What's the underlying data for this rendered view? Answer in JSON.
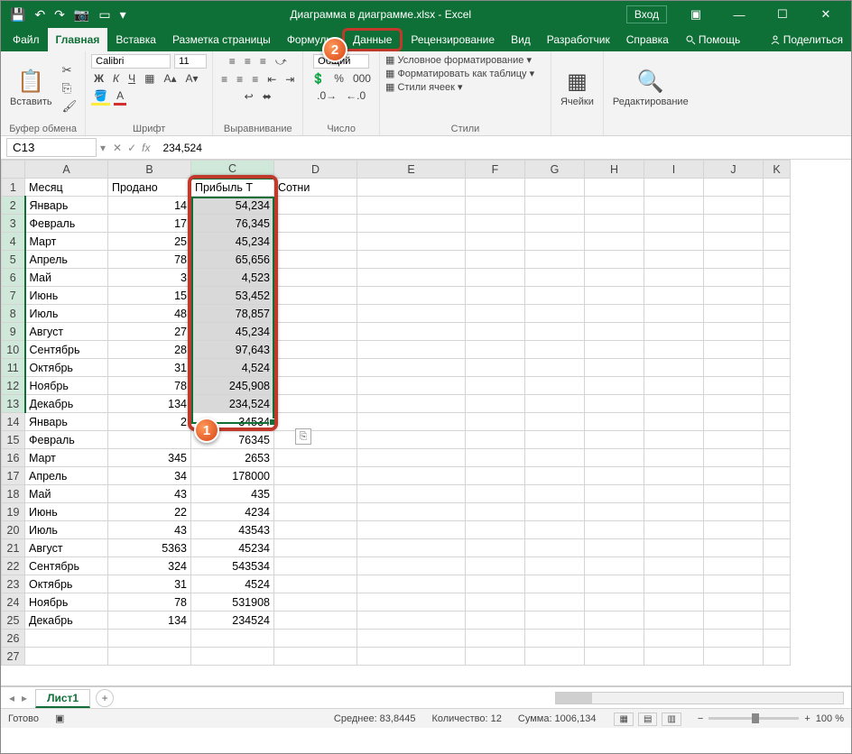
{
  "title": "Диаграмма в диаграмме.xlsx  -  Excel",
  "signin": "Вход",
  "tabs": [
    "Файл",
    "Главная",
    "Вставка",
    "Разметка страницы",
    "Формулы",
    "Данные",
    "Рецензирование",
    "Вид",
    "Разработчик",
    "Справка",
    "Помощь",
    "Поделиться"
  ],
  "ribbon": {
    "clipboard": {
      "paste": "Вставить",
      "label": "Буфер обмена"
    },
    "font": {
      "name": "Calibri",
      "size": "11",
      "label": "Шрифт"
    },
    "align": {
      "label": "Выравнивание"
    },
    "number": {
      "format": "Общий",
      "label": "Число"
    },
    "styles": {
      "cond": "Условное форматирование",
      "table": "Форматировать как таблицу",
      "cell": "Стили ячеек",
      "label": "Стили"
    },
    "cells": {
      "label": "Ячейки"
    },
    "editing": {
      "label": "Редактирование"
    }
  },
  "fx": {
    "name": "C13",
    "formula": "234,524"
  },
  "cols": [
    "A",
    "B",
    "C",
    "D",
    "E",
    "F",
    "G",
    "H",
    "I",
    "J",
    "K"
  ],
  "headers": {
    "A": "Месяц",
    "B": "Продано",
    "C": "Прибыль Т",
    "D": "Сотни"
  },
  "rows": [
    {
      "n": 1,
      "A": "Месяц",
      "B": "Продано",
      "C": "Прибыль Т",
      "D": "Сотни"
    },
    {
      "n": 2,
      "A": "Январь",
      "B": "14",
      "C": "54,234"
    },
    {
      "n": 3,
      "A": "Февраль",
      "B": "17",
      "C": "76,345"
    },
    {
      "n": 4,
      "A": "Март",
      "B": "25",
      "C": "45,234"
    },
    {
      "n": 5,
      "A": "Апрель",
      "B": "78",
      "C": "65,656"
    },
    {
      "n": 6,
      "A": "Май",
      "B": "3",
      "C": "4,523"
    },
    {
      "n": 7,
      "A": "Июнь",
      "B": "15",
      "C": "53,452"
    },
    {
      "n": 8,
      "A": "Июль",
      "B": "48",
      "C": "78,857"
    },
    {
      "n": 9,
      "A": "Август",
      "B": "27",
      "C": "45,234"
    },
    {
      "n": 10,
      "A": "Сентябрь",
      "B": "28",
      "C": "97,643"
    },
    {
      "n": 11,
      "A": "Октябрь",
      "B": "31",
      "C": "4,524"
    },
    {
      "n": 12,
      "A": "Ноябрь",
      "B": "78",
      "C": "245,908"
    },
    {
      "n": 13,
      "A": "Декабрь",
      "B": "134",
      "C": "234,524"
    },
    {
      "n": 14,
      "A": "Январь",
      "B": "2",
      "C": "34534"
    },
    {
      "n": 15,
      "A": "Февраль",
      "B": "",
      "C": "76345"
    },
    {
      "n": 16,
      "A": "Март",
      "B": "345",
      "C": "2653"
    },
    {
      "n": 17,
      "A": "Апрель",
      "B": "34",
      "C": "178000"
    },
    {
      "n": 18,
      "A": "Май",
      "B": "43",
      "C": "435"
    },
    {
      "n": 19,
      "A": "Июнь",
      "B": "22",
      "C": "4234"
    },
    {
      "n": 20,
      "A": "Июль",
      "B": "43",
      "C": "43543"
    },
    {
      "n": 21,
      "A": "Август",
      "B": "5363",
      "C": "45234"
    },
    {
      "n": 22,
      "A": "Сентябрь",
      "B": "324",
      "C": "543534"
    },
    {
      "n": 23,
      "A": "Октябрь",
      "B": "31",
      "C": "4524"
    },
    {
      "n": 24,
      "A": "Ноябрь",
      "B": "78",
      "C": "531908"
    },
    {
      "n": 25,
      "A": "Декабрь",
      "B": "134",
      "C": "234524"
    }
  ],
  "sheet": {
    "name": "Лист1"
  },
  "status": {
    "ready": "Готово",
    "avg": "Среднее: 83,8445",
    "count": "Количество: 12",
    "sum": "Сумма: 1006,134",
    "zoom": "100 %"
  }
}
